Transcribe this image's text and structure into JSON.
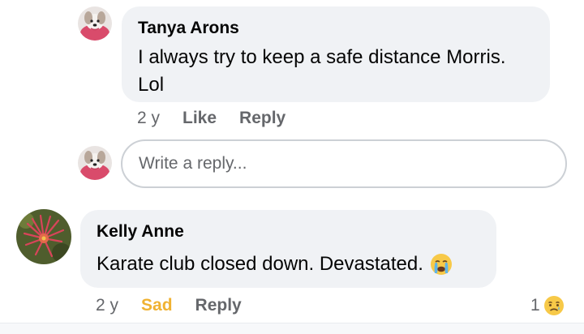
{
  "comments": [
    {
      "author": "Tanya Arons",
      "text_line1": "I always try to keep a safe distance Morris.",
      "text_line2": "Lol",
      "time": "2 y",
      "like_label": "Like",
      "reply_label": "Reply"
    },
    {
      "author": "Kelly Anne",
      "text": "Karate club closed down. Devastated.",
      "emoji_name": "crying-face",
      "time": "2 y",
      "reaction_label": "Sad",
      "reply_label": "Reply",
      "reaction_count": "1",
      "reaction_emoji_name": "sad-face"
    }
  ],
  "reply_box": {
    "placeholder": "Write a reply..."
  },
  "colors": {
    "bubble": "#f0f2f5",
    "muted_text": "#65676b",
    "sad_reaction": "#f0b232"
  }
}
